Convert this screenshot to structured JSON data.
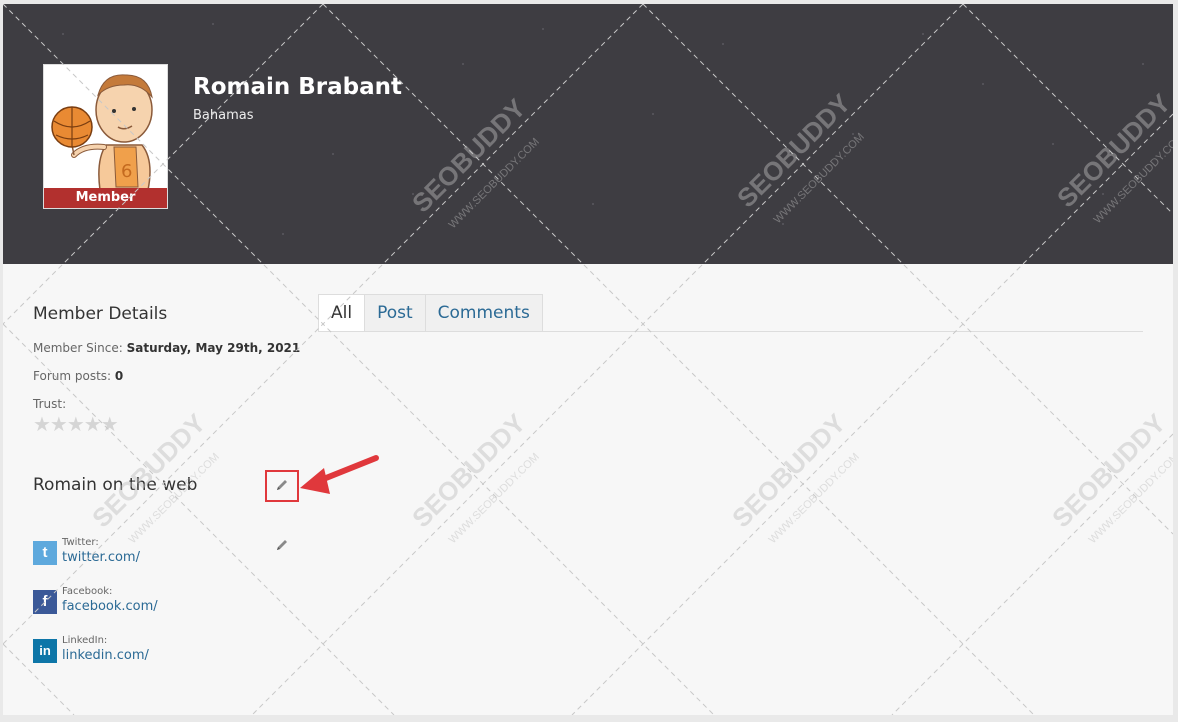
{
  "profile": {
    "name": "Romain Brabant",
    "location": "Bahamas",
    "badge": "Member"
  },
  "member_details": {
    "title": "Member Details",
    "since_label": "Member Since:",
    "since_value": "Saturday, May 29th, 2021",
    "posts_label": "Forum posts:",
    "posts_value": "0",
    "trust_label": "Trust:",
    "trust_stars": "★★★★★",
    "trust_rating": 0
  },
  "web": {
    "title": "Romain on the web",
    "links": [
      {
        "label": "Twitter:",
        "url": "twitter.com/",
        "icon": "t",
        "color": "#5ea9dd"
      },
      {
        "label": "Facebook:",
        "url": "facebook.com/",
        "icon": "f",
        "color": "#3b5998"
      },
      {
        "label": "LinkedIn:",
        "url": "linkedin.com/",
        "icon": "in",
        "color": "#0e76a8"
      }
    ]
  },
  "tabs": [
    {
      "label": "All",
      "active": true
    },
    {
      "label": "Post",
      "active": false
    },
    {
      "label": "Comments",
      "active": false
    }
  ],
  "watermark": {
    "brand": "SEOBUDDY",
    "site": "WWW.SEOBUDDY.COM"
  },
  "colors": {
    "banner": "#3e3d42",
    "badge": "#b2302e",
    "link": "#2b6a95",
    "highlight": "#e0383c"
  }
}
